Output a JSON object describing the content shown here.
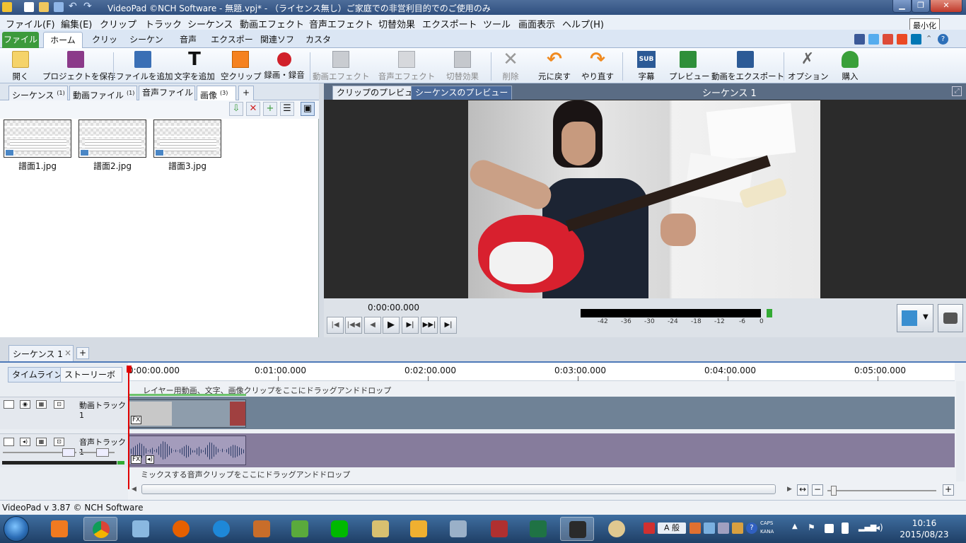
{
  "window": {
    "title": "VideoPad ©NCH Software - 無題.vpj* - （ライセンス無し）ご家庭での非営利目的でのご使用のみ",
    "tooltip": "最小化"
  },
  "menu": [
    "ファイル(F)",
    "編集(E)",
    "クリップ",
    "トラック",
    "シーケンス",
    "動画エフェクト",
    "音声エフェクト",
    "切替効果",
    "エクスポート",
    "ツール",
    "画面表示",
    "ヘルプ(H)"
  ],
  "ribbon_tabs": [
    "ファイル",
    "ホーム",
    "クリップ",
    "シーケンス",
    "音声",
    "エクスポート",
    "関連ソフト",
    "カスタム"
  ],
  "toolbar": {
    "open": "開く",
    "save_project": "プロジェクトを保存",
    "add_file": "ファイルを追加",
    "add_text": "文字を追加",
    "blank_clip": "空クリップ",
    "record": "録画・録音",
    "video_effects": "動画エフェクト",
    "audio_effects": "音声エフェクト",
    "transitions": "切替効果",
    "delete": "削除",
    "undo": "元に戻す",
    "redo": "やり直す",
    "subtitles": "字幕",
    "preview": "プレビュー",
    "export_video": "動画をエクスポート",
    "options": "オプション",
    "buy": "購入",
    "sub_badge": "SUB"
  },
  "bins": {
    "tabs": [
      {
        "label": "シーケンス",
        "count": "(1)"
      },
      {
        "label": "動画ファイル",
        "count": "(1)"
      },
      {
        "label": "音声ファイル",
        "count": ""
      },
      {
        "label": "画像",
        "count": "(3)"
      }
    ],
    "add": "+",
    "images": [
      "譜面1.jpg",
      "譜面2.jpg",
      "譜面3.jpg"
    ]
  },
  "preview": {
    "tab_clip": "クリップのプレビュー",
    "tab_sequence": "シーケンスのプレビュー",
    "title": "シーケンス 1",
    "timecode": "0:00:00.000",
    "meter_ticks": [
      "-42",
      "-36",
      "-30",
      "-24",
      "-18",
      "-12",
      "-6",
      "0"
    ]
  },
  "sequence_tabs": {
    "label": "シーケンス 1",
    "close": "×",
    "add": "+"
  },
  "timeline": {
    "view_timeline": "タイムライン",
    "view_storyboard": "ストーリーボ",
    "ruler": [
      "0:00:00.000",
      "0:01:00.000",
      "0:02:00.000",
      "0:03:00.000",
      "0:04:00.000",
      "0:05:00.000"
    ],
    "video_hint": "レイヤー用動画、文字、画像クリップをここにドラッグアンドドロップ",
    "audio_hint": "ミックスする音声クリップをここにドラッグアンドドロップ",
    "video_track": "動画トラック 1",
    "audio_track": "音声トラック 1",
    "fx": "FX"
  },
  "status": "VideoPad v 3.87 © NCH Software",
  "clock": {
    "time": "10:16",
    "date": "2015/08/23",
    "caps": "CAPS",
    "kana": "KANA",
    "ime": "A 般"
  }
}
